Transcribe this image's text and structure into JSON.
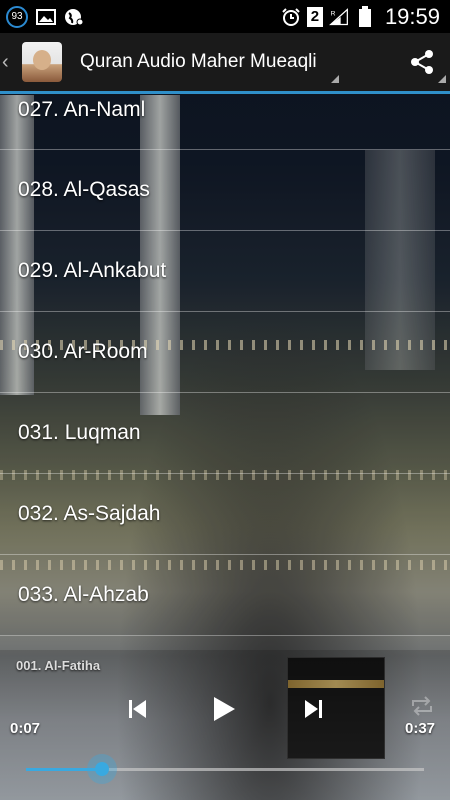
{
  "status_bar": {
    "notification_count": "93",
    "sim_slot": "2",
    "time": "19:59",
    "icons": [
      "notification-counter-icon",
      "image-icon",
      "earth-icon",
      "alarm-icon",
      "sim-2-icon",
      "signal-icon",
      "battery-icon"
    ]
  },
  "action_bar": {
    "title": "Quran Audio Maher Mueaqli",
    "back_icon": "chevron-left-icon",
    "share_icon": "share-icon"
  },
  "surah_list": [
    {
      "label": "027. An-Naml"
    },
    {
      "label": "028. Al-Qasas"
    },
    {
      "label": "029. Al-Ankabut"
    },
    {
      "label": "030. Ar-Room"
    },
    {
      "label": "031. Luqman"
    },
    {
      "label": "032. As-Sajdah"
    },
    {
      "label": "033. Al-Ahzab"
    }
  ],
  "player": {
    "now_playing": "001. Al-Fatiha",
    "elapsed": "0:07",
    "duration": "0:37",
    "progress_fraction": 0.19,
    "accent_color": "#39a9e0"
  },
  "colors": {
    "accent": "#2f8fc9",
    "action_bar_bg": "#1a1a1a",
    "status_bar_bg": "#000000"
  }
}
